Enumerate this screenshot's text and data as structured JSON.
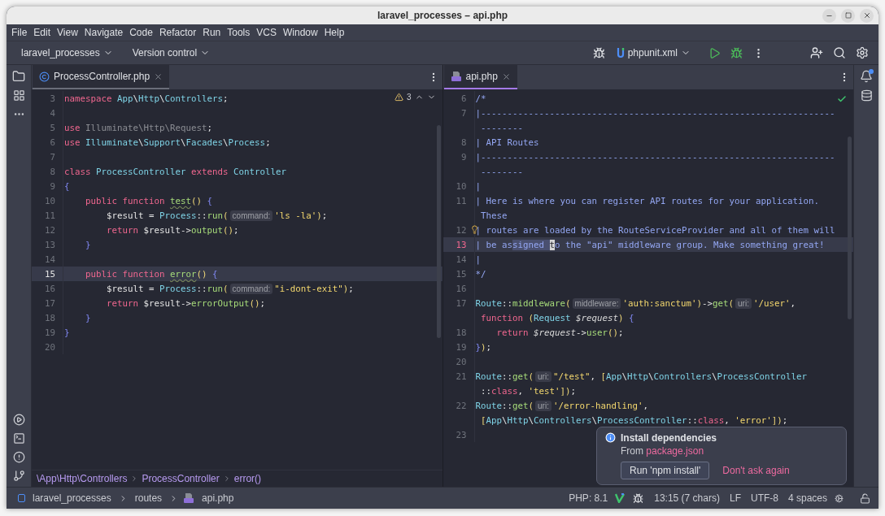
{
  "window": {
    "title": "laravel_processes – api.php"
  },
  "menu": [
    "File",
    "Edit",
    "View",
    "Navigate",
    "Code",
    "Refactor",
    "Run",
    "Tools",
    "VCS",
    "Window",
    "Help"
  ],
  "toolbar": {
    "project": "laravel_processes",
    "vcs": "Version control",
    "run_config": "phpunit.xml"
  },
  "left_editor": {
    "tab": {
      "label": "ProcessController.php",
      "focused": false
    },
    "warnings": "3",
    "lines": [
      {
        "kind": "line",
        "number": "3",
        "current": false,
        "tokens": [
          {
            "kind": "kw",
            "text": "namespace "
          },
          {
            "kind": "type",
            "text": "App"
          },
          {
            "kind": "plain",
            "text": "\\"
          },
          {
            "kind": "type",
            "text": "Http"
          },
          {
            "kind": "plain",
            "text": "\\"
          },
          {
            "kind": "type",
            "text": "Controllers"
          },
          {
            "kind": "plain",
            "text": ";"
          }
        ]
      },
      {
        "kind": "line",
        "number": "4",
        "current": false
      },
      {
        "kind": "line",
        "number": "5",
        "current": false,
        "tokens": [
          {
            "kind": "kw",
            "text": "use "
          },
          {
            "kind": "unused",
            "text": "Illuminate\\Http\\Request"
          },
          {
            "kind": "plain",
            "text": ";"
          }
        ]
      },
      {
        "kind": "line",
        "number": "6",
        "current": false,
        "tokens": [
          {
            "kind": "kw",
            "text": "use "
          },
          {
            "kind": "type",
            "text": "Illuminate"
          },
          {
            "kind": "plain",
            "text": "\\"
          },
          {
            "kind": "type",
            "text": "Support"
          },
          {
            "kind": "plain",
            "text": "\\"
          },
          {
            "kind": "type",
            "text": "Facades"
          },
          {
            "kind": "plain",
            "text": "\\"
          },
          {
            "kind": "type",
            "text": "Process"
          },
          {
            "kind": "plain",
            "text": ";"
          }
        ]
      },
      {
        "kind": "line",
        "number": "7",
        "current": false
      },
      {
        "kind": "line",
        "number": "8",
        "current": false,
        "tokens": [
          {
            "kind": "kw",
            "text": "class "
          },
          {
            "kind": "type",
            "text": "ProcessController "
          },
          {
            "kind": "kw",
            "text": "extends "
          },
          {
            "kind": "type",
            "text": "Controller"
          }
        ]
      },
      {
        "kind": "line",
        "number": "9",
        "current": false,
        "tokens": [
          {
            "kind": "brace",
            "text": "{"
          }
        ]
      },
      {
        "kind": "line",
        "number": "10",
        "current": false,
        "tokens": [
          {
            "kind": "kw",
            "text": "    public function "
          },
          {
            "kind": "typo",
            "text": "test"
          },
          {
            "kind": "paren",
            "text": "() "
          },
          {
            "kind": "brace",
            "text": "{"
          }
        ]
      },
      {
        "kind": "line",
        "number": "11",
        "current": false,
        "tokens": [
          {
            "kind": "plain",
            "text": "        $result = "
          },
          {
            "kind": "type",
            "text": "Process"
          },
          {
            "kind": "plain",
            "text": "::"
          },
          {
            "kind": "func",
            "text": "run"
          },
          {
            "kind": "paren",
            "text": "("
          },
          {
            "kind": "hint",
            "text": "command:"
          },
          {
            "kind": "str",
            "text": "'ls -la'"
          },
          {
            "kind": "paren",
            "text": ")"
          },
          {
            "kind": "plain",
            "text": ";"
          }
        ]
      },
      {
        "kind": "line",
        "number": "12",
        "current": false,
        "tokens": [
          {
            "kind": "kw",
            "text": "        return "
          },
          {
            "kind": "plain",
            "text": "$result->"
          },
          {
            "kind": "func",
            "text": "output"
          },
          {
            "kind": "paren",
            "text": "()"
          },
          {
            "kind": "plain",
            "text": ";"
          }
        ]
      },
      {
        "kind": "line",
        "number": "13",
        "current": false,
        "tokens": [
          {
            "kind": "brace",
            "text": "    }"
          }
        ]
      },
      {
        "kind": "line",
        "number": "14",
        "current": false
      },
      {
        "kind": "line",
        "number": "15",
        "current": true,
        "tokens": [
          {
            "kind": "kw",
            "text": "    public function "
          },
          {
            "kind": "typo",
            "text": "error"
          },
          {
            "kind": "paren",
            "text": "() "
          },
          {
            "kind": "brace",
            "text": "{"
          }
        ]
      },
      {
        "kind": "line",
        "number": "16",
        "current": false,
        "tokens": [
          {
            "kind": "plain",
            "text": "        $result = "
          },
          {
            "kind": "type",
            "text": "Process"
          },
          {
            "kind": "plain",
            "text": "::"
          },
          {
            "kind": "func",
            "text": "run"
          },
          {
            "kind": "paren",
            "text": "("
          },
          {
            "kind": "hint",
            "text": "command:"
          },
          {
            "kind": "str",
            "text": "\"i-dont-exit\""
          },
          {
            "kind": "paren",
            "text": ")"
          },
          {
            "kind": "plain",
            "text": ";"
          }
        ]
      },
      {
        "kind": "line",
        "number": "17",
        "current": false,
        "tokens": [
          {
            "kind": "kw",
            "text": "        return "
          },
          {
            "kind": "plain",
            "text": "$result->"
          },
          {
            "kind": "func",
            "text": "errorOutput"
          },
          {
            "kind": "paren",
            "text": "()"
          },
          {
            "kind": "plain",
            "text": ";"
          }
        ]
      },
      {
        "kind": "line",
        "number": "18",
        "current": false,
        "tokens": [
          {
            "kind": "brace",
            "text": "    }"
          }
        ]
      },
      {
        "kind": "line",
        "number": "19",
        "current": false,
        "tokens": [
          {
            "kind": "brace",
            "text": "}"
          }
        ]
      },
      {
        "kind": "line",
        "number": "20",
        "current": false
      }
    ],
    "breadcrumbs": [
      "\\App\\Http\\Controllers",
      "ProcessController",
      "error()"
    ]
  },
  "right_editor": {
    "tab": {
      "label": "api.php",
      "focused": true
    },
    "lines": [
      {
        "kind": "line",
        "number": "6",
        "current": false,
        "tokens": [
          {
            "kind": "comment",
            "text": "/*"
          }
        ]
      },
      {
        "kind": "line",
        "number": "7",
        "current": false,
        "tokens": [
          {
            "kind": "comment",
            "text": "|-------------------------------------------------------------------"
          }
        ]
      },
      {
        "kind": "wrap",
        "tokens": [
          {
            "kind": "comment",
            "text": " --------"
          }
        ]
      },
      {
        "kind": "line",
        "number": "8",
        "current": false,
        "tokens": [
          {
            "kind": "comment",
            "text": "| API Routes"
          }
        ]
      },
      {
        "kind": "line",
        "number": "9",
        "current": false,
        "tokens": [
          {
            "kind": "comment",
            "text": "|-------------------------------------------------------------------"
          }
        ]
      },
      {
        "kind": "wrap",
        "tokens": [
          {
            "kind": "comment",
            "text": " --------"
          }
        ]
      },
      {
        "kind": "line",
        "number": "10",
        "current": false,
        "tokens": [
          {
            "kind": "comment",
            "text": "|"
          }
        ]
      },
      {
        "kind": "line",
        "number": "11",
        "current": false,
        "tokens": [
          {
            "kind": "comment",
            "text": "| Here is where you can register API routes for your application."
          }
        ]
      },
      {
        "kind": "wrap",
        "tokens": [
          {
            "kind": "comment",
            "text": " These"
          }
        ]
      },
      {
        "kind": "line",
        "number": "12",
        "current": false,
        "bulb": true,
        "tokens": [
          {
            "kind": "comment",
            "text": "| routes are loaded by the RouteServiceProvider and all of them will"
          }
        ]
      },
      {
        "kind": "line",
        "number": "13",
        "current": true,
        "tokens": [
          {
            "kind": "comment",
            "text": "| be as"
          },
          {
            "kind": "sel",
            "text": "signed "
          },
          {
            "kind": "caret",
            "text": "t"
          },
          {
            "kind": "comment",
            "text": "o the \"api\" middleware group. Make something great!"
          }
        ]
      },
      {
        "kind": "line",
        "number": "14",
        "current": false,
        "tokens": [
          {
            "kind": "comment",
            "text": "|"
          }
        ]
      },
      {
        "kind": "line",
        "number": "15",
        "current": false,
        "tokens": [
          {
            "kind": "comment",
            "text": "*/"
          }
        ]
      },
      {
        "kind": "line",
        "number": "16",
        "current": false
      },
      {
        "kind": "line",
        "number": "17",
        "current": false,
        "tokens": [
          {
            "kind": "type",
            "text": "Route"
          },
          {
            "kind": "plain",
            "text": "::"
          },
          {
            "kind": "func",
            "text": "middleware"
          },
          {
            "kind": "paren",
            "text": "("
          },
          {
            "kind": "hint",
            "text": "middleware:"
          },
          {
            "kind": "str",
            "text": "'auth:sanctum'"
          },
          {
            "kind": "paren",
            "text": ")"
          },
          {
            "kind": "plain",
            "text": "->"
          },
          {
            "kind": "func",
            "text": "get"
          },
          {
            "kind": "paren",
            "text": "("
          },
          {
            "kind": "hint",
            "text": "uri:"
          },
          {
            "kind": "str",
            "text": "'/user'"
          },
          {
            "kind": "plain",
            "text": ","
          }
        ]
      },
      {
        "kind": "wrap",
        "tokens": [
          {
            "kind": "kw",
            "text": " function "
          },
          {
            "kind": "paren",
            "text": "("
          },
          {
            "kind": "type",
            "text": "Request "
          },
          {
            "kind": "param",
            "text": "$request"
          },
          {
            "kind": "paren",
            "text": ") "
          },
          {
            "kind": "brace",
            "text": "{"
          }
        ]
      },
      {
        "kind": "line",
        "number": "18",
        "current": false,
        "tokens": [
          {
            "kind": "kw",
            "text": "    return "
          },
          {
            "kind": "param",
            "text": "$request"
          },
          {
            "kind": "plain",
            "text": "->"
          },
          {
            "kind": "func",
            "text": "user"
          },
          {
            "kind": "paren",
            "text": "()"
          },
          {
            "kind": "plain",
            "text": ";"
          }
        ]
      },
      {
        "kind": "line",
        "number": "19",
        "current": false,
        "tokens": [
          {
            "kind": "brace",
            "text": "}"
          },
          {
            "kind": "paren",
            "text": ")"
          },
          {
            "kind": "plain",
            "text": ";"
          }
        ]
      },
      {
        "kind": "line",
        "number": "20",
        "current": false
      },
      {
        "kind": "line",
        "number": "21",
        "current": false,
        "tokens": [
          {
            "kind": "type",
            "text": "Route"
          },
          {
            "kind": "plain",
            "text": "::"
          },
          {
            "kind": "func",
            "text": "get"
          },
          {
            "kind": "paren",
            "text": "("
          },
          {
            "kind": "hint",
            "text": "uri:"
          },
          {
            "kind": "str",
            "text": "\"/test\""
          },
          {
            "kind": "plain",
            "text": ", "
          },
          {
            "kind": "paren",
            "text": "["
          },
          {
            "kind": "type",
            "text": "App"
          },
          {
            "kind": "plain",
            "text": "\\"
          },
          {
            "kind": "type",
            "text": "Http"
          },
          {
            "kind": "plain",
            "text": "\\"
          },
          {
            "kind": "type",
            "text": "Controllers"
          },
          {
            "kind": "plain",
            "text": "\\"
          },
          {
            "kind": "type",
            "text": "ProcessController"
          }
        ]
      },
      {
        "kind": "wrap",
        "tokens": [
          {
            "kind": "plain",
            "text": " ::"
          },
          {
            "kind": "kw",
            "text": "class"
          },
          {
            "kind": "plain",
            "text": ", "
          },
          {
            "kind": "str",
            "text": "'test'"
          },
          {
            "kind": "paren",
            "text": "])"
          },
          {
            "kind": "plain",
            "text": ";"
          }
        ]
      },
      {
        "kind": "line",
        "number": "22",
        "current": false,
        "tokens": [
          {
            "kind": "type",
            "text": "Route"
          },
          {
            "kind": "plain",
            "text": "::"
          },
          {
            "kind": "func",
            "text": "get"
          },
          {
            "kind": "paren",
            "text": "("
          },
          {
            "kind": "hint",
            "text": "uri:"
          },
          {
            "kind": "str",
            "text": "'/error-handling'"
          },
          {
            "kind": "plain",
            "text": ","
          }
        ]
      },
      {
        "kind": "wrap",
        "tokens": [
          {
            "kind": "paren",
            "text": " ["
          },
          {
            "kind": "type",
            "text": "App"
          },
          {
            "kind": "plain",
            "text": "\\"
          },
          {
            "kind": "type",
            "text": "Http"
          },
          {
            "kind": "plain",
            "text": "\\"
          },
          {
            "kind": "type",
            "text": "Controllers"
          },
          {
            "kind": "plain",
            "text": "\\"
          },
          {
            "kind": "type",
            "text": "ProcessController"
          },
          {
            "kind": "plain",
            "text": "::"
          },
          {
            "kind": "kw",
            "text": "class"
          },
          {
            "kind": "plain",
            "text": ", "
          },
          {
            "kind": "str",
            "text": "'error'"
          },
          {
            "kind": "paren",
            "text": "])"
          },
          {
            "kind": "plain",
            "text": ";"
          }
        ]
      },
      {
        "kind": "line",
        "number": "23",
        "current": false
      }
    ]
  },
  "notification": {
    "title": "Install dependencies",
    "message": "From",
    "link": "package.json",
    "action": "Run 'npm install'",
    "dismiss": "Don't ask again"
  },
  "status_bar": {
    "path": [
      {
        "label": "laravel_processes",
        "kind": "module"
      },
      {
        "label": "routes",
        "kind": "folder"
      },
      {
        "label": "api.php",
        "kind": "php"
      }
    ],
    "php": "PHP: 8.1",
    "position": "13:15 (7 chars)",
    "line_ending": "LF",
    "encoding": "UTF-8",
    "indent": "4 spaces"
  }
}
